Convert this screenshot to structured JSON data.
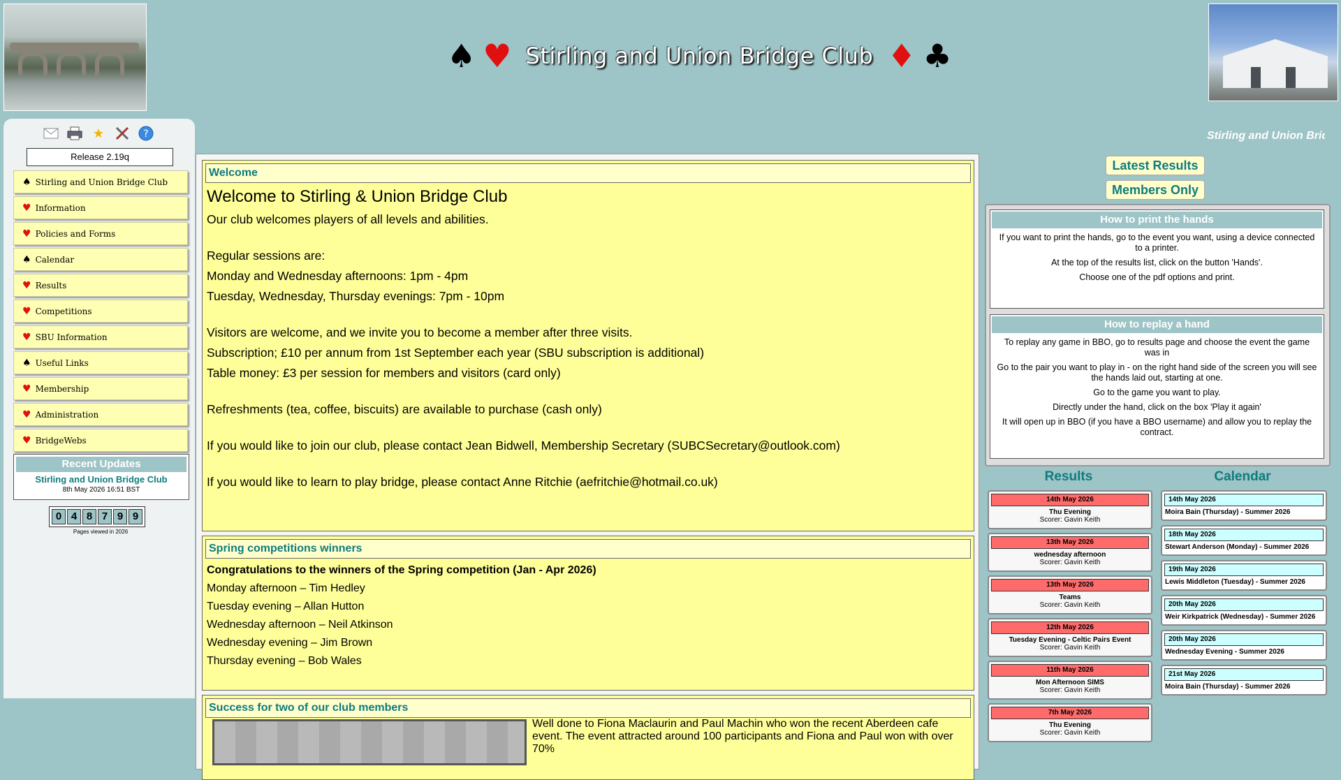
{
  "header": {
    "title": "Stirling and Union Bridge Club",
    "left_suits": [
      "♠",
      "♥"
    ],
    "right_suits": [
      "♦",
      "♣"
    ]
  },
  "sidebar": {
    "toolbar_icons": [
      "envelope-icon",
      "printer-icon",
      "star-icon",
      "tools-icon",
      "help-icon"
    ],
    "release": "Release 2.19q",
    "menu": [
      {
        "suit": "♠",
        "suit_color": "#000000",
        "label": "Stirling and Union Bridge Club"
      },
      {
        "suit": "♥",
        "suit_color": "#e01010",
        "label": "Information"
      },
      {
        "suit": "♥",
        "suit_color": "#e01010",
        "label": "Policies and Forms"
      },
      {
        "suit": "♠",
        "suit_color": "#000000",
        "label": "Calendar"
      },
      {
        "suit": "♥",
        "suit_color": "#e01010",
        "label": "Results"
      },
      {
        "suit": "♥",
        "suit_color": "#e01010",
        "label": "Competitions"
      },
      {
        "suit": "♥",
        "suit_color": "#e01010",
        "label": "SBU Information"
      },
      {
        "suit": "♠",
        "suit_color": "#000000",
        "label": "Useful Links"
      },
      {
        "suit": "♥",
        "suit_color": "#e01010",
        "label": "Membership"
      },
      {
        "suit": "♥",
        "suit_color": "#e01010",
        "label": "Administration"
      },
      {
        "suit": "♥",
        "suit_color": "#e01010",
        "label": "BridgeWebs"
      }
    ],
    "recent_updates": {
      "heading": "Recent Updates",
      "link": "Stirling and Union Bridge Club",
      "date": "8th May 2026 16:51 BST"
    },
    "counter": {
      "digits": [
        "0",
        "4",
        "8",
        "7",
        "9",
        "9"
      ],
      "label": "Pages viewed in 2026"
    }
  },
  "ticker": {
    "text": "Stirling and Union Bridge Club"
  },
  "main": {
    "welcome": {
      "heading": "Welcome",
      "title": "Welcome to Stirling & Union Bridge Club",
      "lines": [
        "Our club welcomes players of all levels and abilities.",
        "",
        "Regular sessions are:",
        "Monday and Wednesday afternoons: 1pm - 4pm",
        "Tuesday, Wednesday, Thursday evenings: 7pm - 10pm",
        "",
        "Visitors are welcome, and we invite you to become a member after three visits.",
        "Subscription; £10 per annum from 1st September each year (SBU subscription is additional)",
        "Table money: £3 per session for members and visitors (card only)",
        "",
        "Refreshments (tea, coffee, biscuits) are available to purchase (cash only)",
        "",
        "If you would like to join our club, please contact Jean Bidwell, Membership Secretary (SUBCSecretary@outlook.com)",
        "",
        "If you would like to learn to play bridge, please contact Anne Ritchie (aefritchie@hotmail.co.uk)"
      ]
    },
    "spring": {
      "heading": "Spring competitions winners",
      "intro": "Congratulations to the winners of the Spring competition (Jan - Apr 2026)",
      "winners": [
        "Monday afternoon – Tim Hedley",
        "Tuesday evening – Allan Hutton",
        "Wednesday afternoon – Neil Atkinson",
        "Wednesday evening – Jim Brown",
        "Thursday evening – Bob Wales"
      ]
    },
    "success": {
      "heading": "Success for two of our club members",
      "text": "Well done to Fiona Maclaurin and Paul Machin who won the recent Aberdeen cafe event.  The event attracted around 100 participants and Fiona and Paul won with over 70%"
    }
  },
  "right": {
    "latest_results": "Latest Results",
    "members_only": "Members Only",
    "print_hands": {
      "heading": "How to print the hands",
      "lines": [
        "If you want to print the hands, go to the event you want, using a device connected to a printer.",
        "At the top of the results list, click on the button 'Hands'.",
        "Choose one of the pdf options and print."
      ]
    },
    "replay_hand": {
      "heading": "How to replay a hand",
      "lines": [
        "To replay any game in BBO, go to results page and choose the event the game was in",
        "Go to the pair you want to play in - on the right hand side of the screen you will see the hands laid out, starting at one.",
        "Go to the game you want to play.",
        "Directly under the hand, click on the box 'Play it again'",
        "It will open up in BBO (if you have a BBO username) and allow you to replay the contract."
      ]
    },
    "results": {
      "heading": "Results",
      "items": [
        {
          "date": "14th May 2026",
          "name": "Thu Evening",
          "scorer": "Scorer: Gavin Keith"
        },
        {
          "date": "13th May 2026",
          "name": "wednesday afternoon",
          "scorer": "Scorer: Gavin Keith"
        },
        {
          "date": "13th May 2026",
          "name": "Teams",
          "scorer": "Scorer: Gavin Keith"
        },
        {
          "date": "12th May 2026",
          "name": "Tuesday Evening - Celtic Pairs Event",
          "scorer": "Scorer: Gavin Keith"
        },
        {
          "date": "11th May 2026",
          "name": "Mon Afternoon SIMS",
          "scorer": "Scorer: Gavin Keith"
        },
        {
          "date": "7th May 2026",
          "name": "Thu Evening",
          "scorer": "Scorer: Gavin Keith"
        }
      ]
    },
    "calendar": {
      "heading": "Calendar",
      "items": [
        {
          "date": "14th May 2026",
          "name": "Moira Bain (Thursday) - Summer 2026"
        },
        {
          "date": "18th May 2026",
          "name": "Stewart Anderson (Monday) - Summer 2026"
        },
        {
          "date": "19th May 2026",
          "name": "Lewis Middleton (Tuesday) - Summer 2026"
        },
        {
          "date": "20th May 2026",
          "name": "Weir Kirkpatrick (Wednesday) - Summer 2026"
        },
        {
          "date": "20th May 2026",
          "name": "Wednesday Evening - Summer 2026"
        },
        {
          "date": "21st May 2026",
          "name": "Moira Bain (Thursday) - Summer 2026"
        }
      ]
    }
  }
}
